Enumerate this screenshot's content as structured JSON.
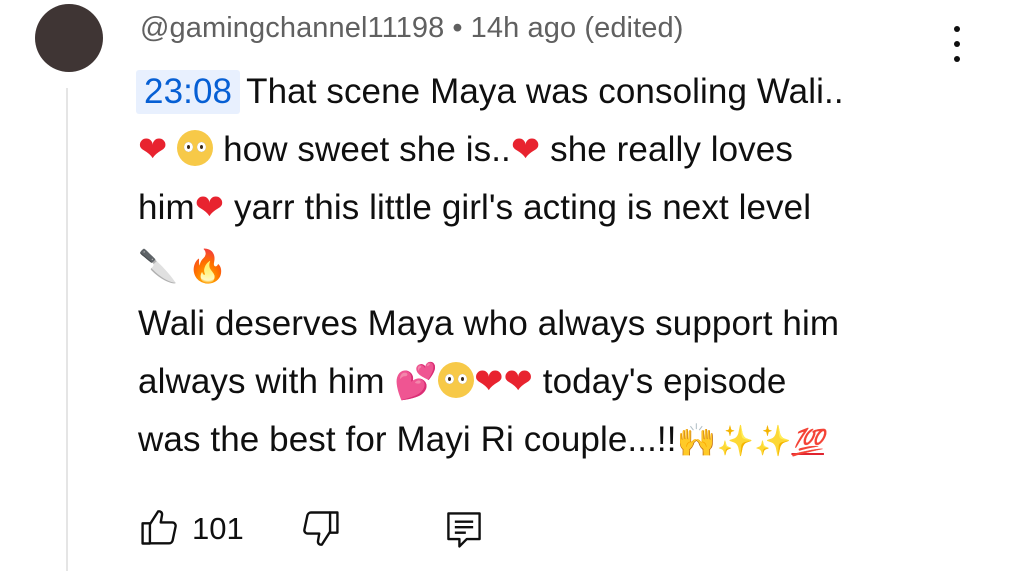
{
  "comment": {
    "author": "@gamingchannel11198",
    "separator": "•",
    "time": "14h ago",
    "edited": "(edited)",
    "timestamp_link": "23:08",
    "lines": [
      {
        "text1": "That scene Maya was consoling Wali.."
      },
      {
        "text1": "how sweet she is..",
        "text2": "she really loves"
      },
      {
        "text1": "him",
        "text2": "yarr this little girl's acting is next level"
      },
      {},
      {
        "text1": "Wali deserves Maya who always support him"
      },
      {
        "text1": "always with him",
        "text2": "today's episode"
      },
      {
        "text1": "was the best for Mayi Ri couple...!!"
      }
    ],
    "like_count": "101"
  },
  "icons": {
    "menu": "more-vert-icon",
    "like": "thumb-up-icon",
    "dislike": "thumb-down-icon",
    "reply": "reply-comment-icon",
    "emoji": [
      "red-heart",
      "pleading-face",
      "kitchen-knife",
      "fire",
      "two-hearts",
      "raising-hands",
      "sparkles",
      "hundred-points"
    ]
  },
  "colors": {
    "timestamp_link": "#065fd4",
    "timestamp_bg": "#e8f0fe",
    "meta_text": "#606060"
  }
}
